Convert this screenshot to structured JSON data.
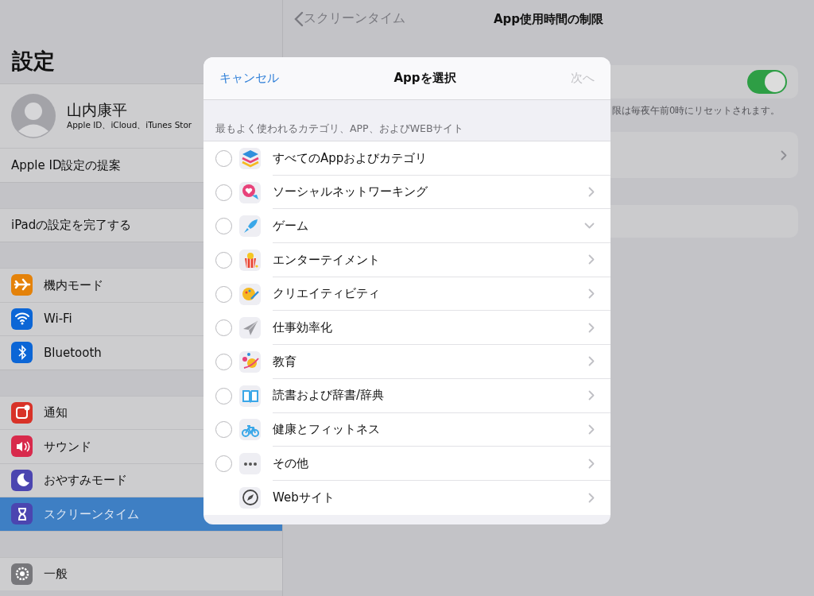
{
  "sidebar": {
    "title": "設定",
    "profile": {
      "name": "山内康平",
      "subtitle": "Apple ID、iCloud、iTunes Stor"
    },
    "groups": [
      [
        {
          "label": "Apple ID設定の提案",
          "selected": false
        }
      ],
      [
        {
          "label": "iPadの設定を完了する",
          "selected": false
        }
      ],
      [
        {
          "label": "機内モード",
          "selected": false,
          "color": "#e4820a"
        },
        {
          "label": "Wi-Fi",
          "selected": false,
          "color": "#0c66d6"
        },
        {
          "label": "Bluetooth",
          "selected": false,
          "color": "#0c66d6"
        }
      ],
      [
        {
          "label": "通知",
          "selected": false,
          "color": "#d83228"
        },
        {
          "label": "サウンド",
          "selected": false,
          "color": "#d82a4c"
        },
        {
          "label": "おやすみモード",
          "selected": false,
          "color": "#4b45b0"
        },
        {
          "label": "スクリーンタイム",
          "selected": true,
          "color": "#4b45b0"
        }
      ],
      [
        {
          "label": "一般",
          "selected": false,
          "color": "#77777b"
        }
      ]
    ]
  },
  "detail": {
    "back_label": "スクリーンタイム",
    "title": "App使用時間の制限",
    "limits_on": true,
    "footnote": "限は毎夜午前0時にリセットされます。"
  },
  "modal": {
    "cancel": "キャンセル",
    "title": "Appを選択",
    "next": {
      "label": "次へ",
      "disabled": true
    },
    "section_header": "最もよく使われるカテゴリ、APP、およびWEBサイト",
    "rows": [
      {
        "kind": "all",
        "label": "すべてのAppおよびカテゴリ",
        "checked": false
      },
      {
        "kind": "category",
        "label": "ソーシャルネットワーキング",
        "checked": false,
        "expanded": false
      },
      {
        "kind": "category",
        "label": "ゲーム",
        "checked": false,
        "expanded": true
      },
      {
        "kind": "category",
        "label": "エンターテイメント",
        "checked": false,
        "expanded": false
      },
      {
        "kind": "category",
        "label": "クリエイティビティ",
        "checked": false,
        "expanded": false
      },
      {
        "kind": "category",
        "label": "仕事効率化",
        "checked": false,
        "expanded": false
      },
      {
        "kind": "category",
        "label": "教育",
        "checked": false,
        "expanded": false
      },
      {
        "kind": "category",
        "label": "読書および辞書/辞典",
        "checked": false,
        "expanded": false
      },
      {
        "kind": "category",
        "label": "健康とフィットネス",
        "checked": false,
        "expanded": false
      },
      {
        "kind": "category",
        "label": "その他",
        "checked": false,
        "expanded": false
      },
      {
        "kind": "website",
        "label": "Webサイト"
      }
    ]
  }
}
